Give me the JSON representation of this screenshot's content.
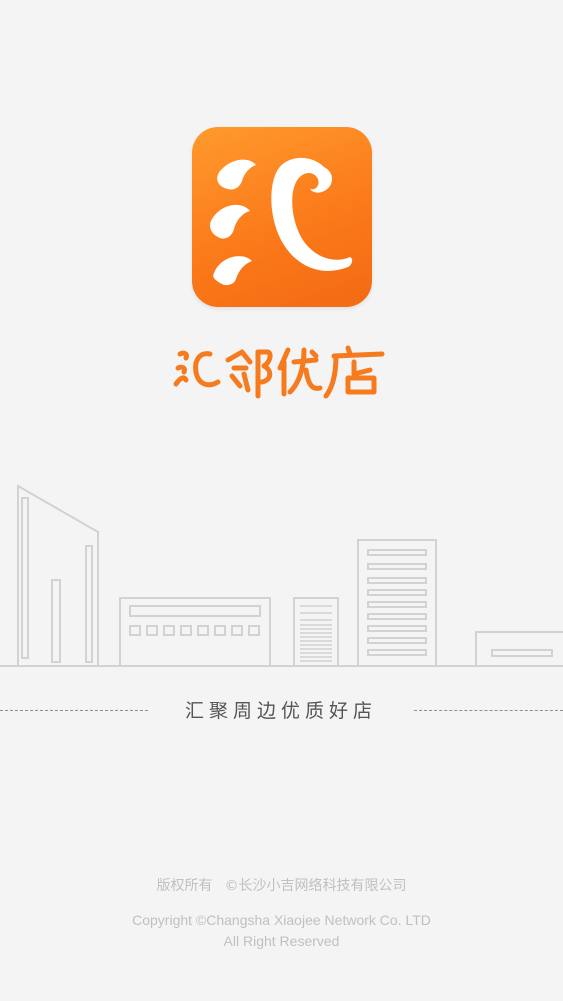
{
  "app": {
    "icon_name": "hui-app-logo-icon",
    "brand_name": "汇邻优店",
    "brand_color": "#f57b1e",
    "slogan": "汇聚周边优质好店"
  },
  "footer": {
    "rights_label": "版权所有",
    "company_cn": "©长沙小吉网络科技有限公司",
    "copyright_en": "Copyright ©Changsha Xiaojee Network Co. LTD",
    "all_rights": "All Right Reserved"
  },
  "illustration": {
    "name": "city-skyline",
    "stroke_color": "#d2d2d2"
  }
}
